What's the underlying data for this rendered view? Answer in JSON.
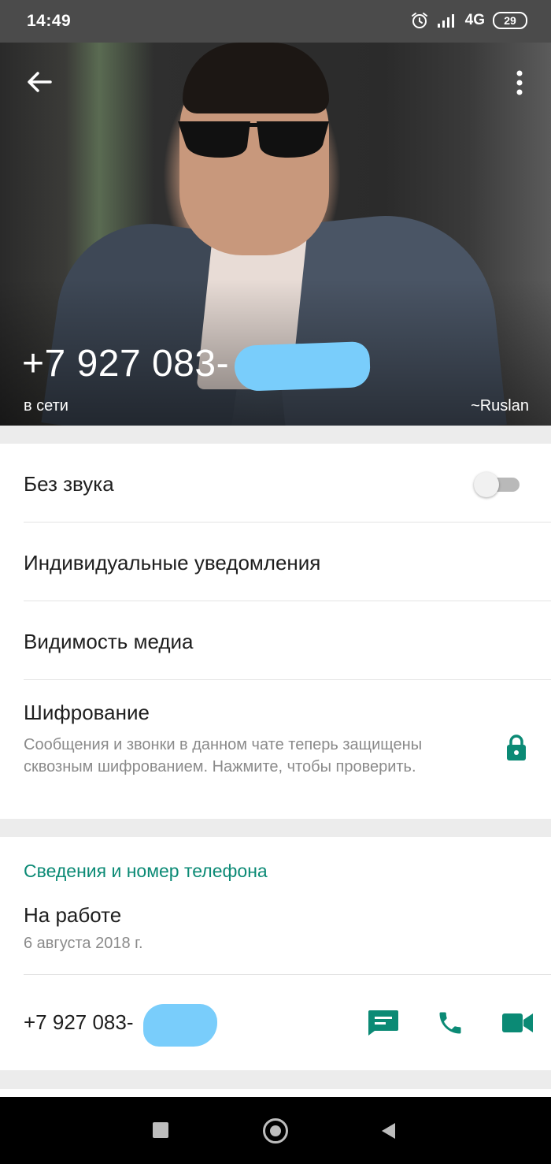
{
  "status_bar": {
    "time": "14:49",
    "network": "4G",
    "battery": "29",
    "icons": [
      "alarm-icon",
      "signal-icon"
    ]
  },
  "header": {
    "number": "+7 927 083-",
    "presence": "в сети",
    "push_name": "~Ruslan",
    "icons": [
      "back-arrow-icon",
      "more-vert-icon"
    ]
  },
  "settings": {
    "mute_label": "Без звука",
    "mute_on": false,
    "custom_notifications_label": "Индивидуальные уведомления",
    "media_visibility_label": "Видимость медиа",
    "encryption_label": "Шифрование",
    "encryption_description": "Сообщения и звонки в данном чате теперь защищены сквозным шифрованием. Нажмите, чтобы проверить."
  },
  "info": {
    "section_title": "Сведения и номер телефона",
    "about": "На работе",
    "about_date": "6 августа 2018 г.",
    "phone": "+7 927 083-",
    "actions": [
      "message-icon",
      "phone-call-icon",
      "video-call-icon"
    ]
  },
  "colors": {
    "accent": "#0b8a75",
    "redaction": "#79cdfb"
  }
}
